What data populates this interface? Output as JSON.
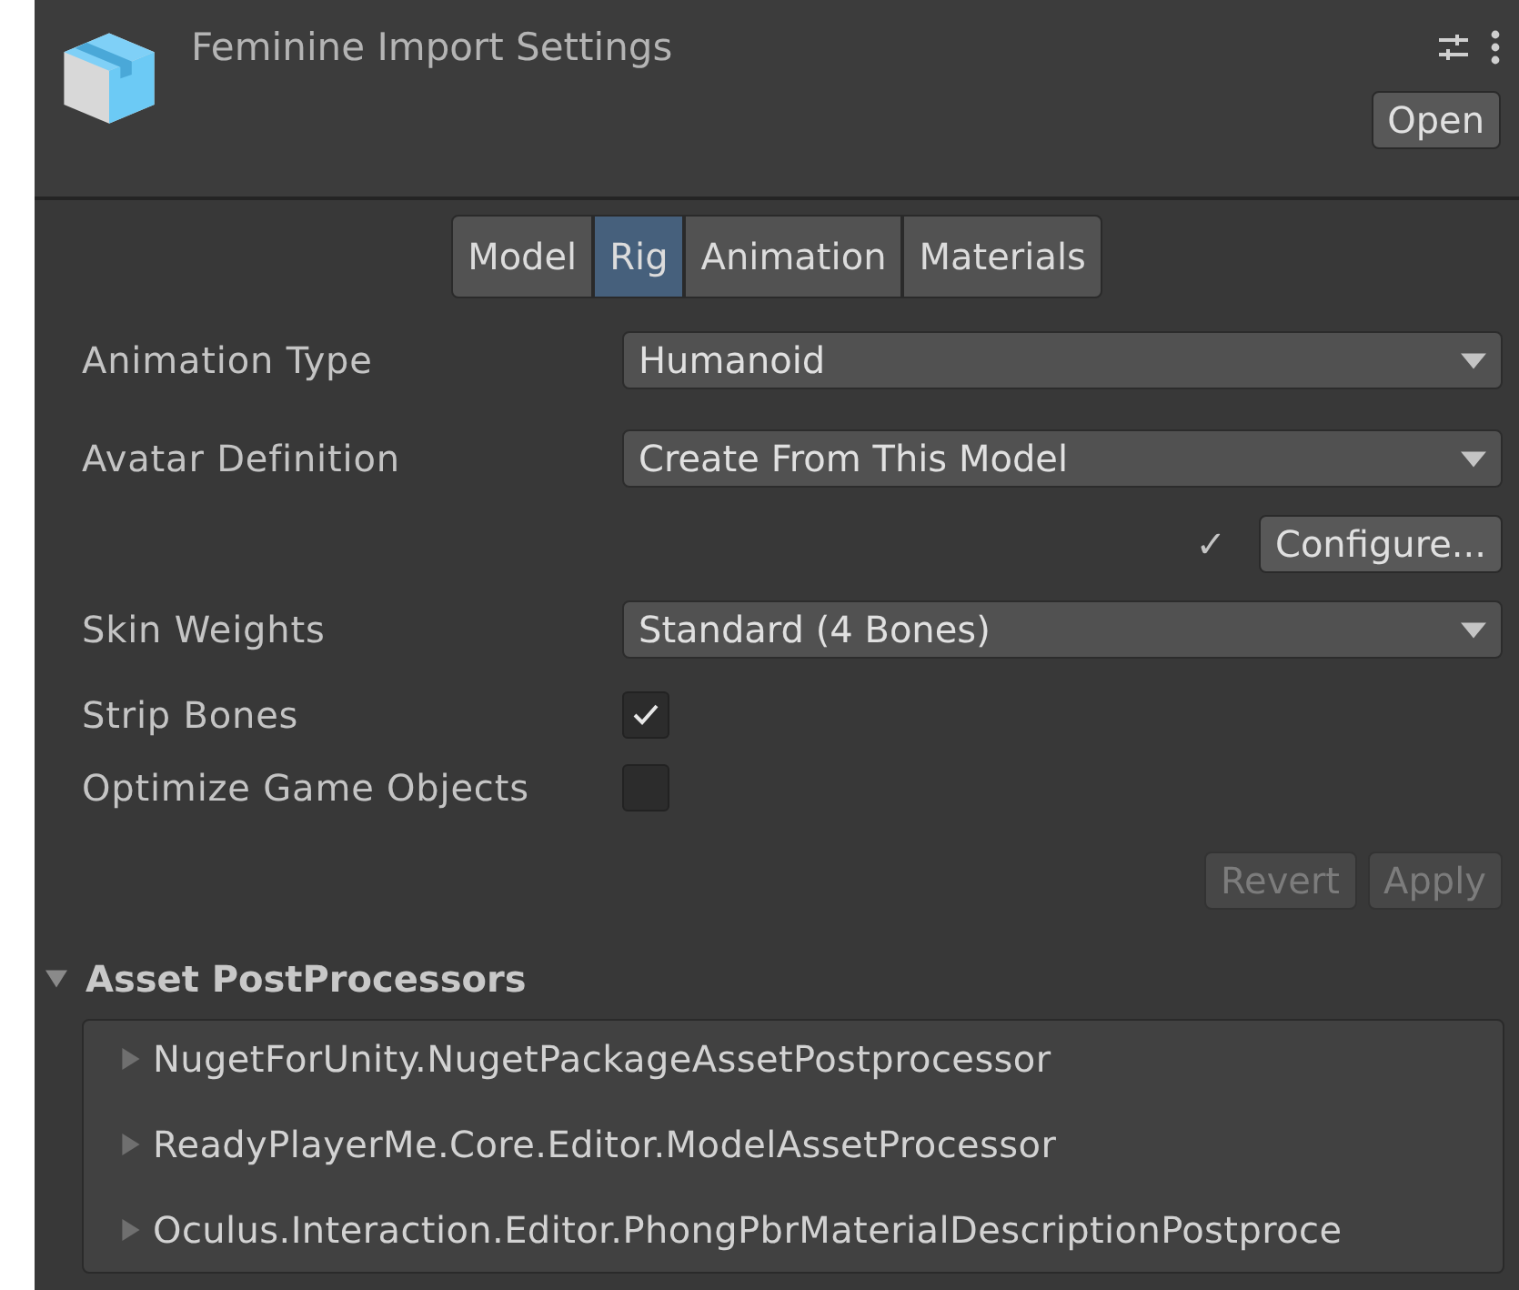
{
  "header": {
    "title": "Feminine Import Settings",
    "open_button": "Open"
  },
  "tabs": [
    {
      "label": "Model",
      "selected": false
    },
    {
      "label": "Rig",
      "selected": true
    },
    {
      "label": "Animation",
      "selected": false
    },
    {
      "label": "Materials",
      "selected": false
    }
  ],
  "fields": [
    {
      "kind": "dropdown",
      "label": "Animation Type",
      "value": "Humanoid"
    },
    {
      "kind": "dropdown",
      "label": "Avatar Definition",
      "value": "Create From This Model"
    },
    {
      "kind": "configure",
      "check": "✓",
      "button": "Configure..."
    },
    {
      "kind": "dropdown",
      "label": "Skin Weights",
      "value": "Standard (4 Bones)"
    },
    {
      "kind": "checkbox",
      "label": "Strip Bones",
      "checked": true
    },
    {
      "kind": "checkbox",
      "label": "Optimize Game Objects",
      "checked": false
    }
  ],
  "actions": [
    {
      "label": "Revert",
      "disabled": true
    },
    {
      "label": "Apply",
      "disabled": true
    }
  ],
  "postprocessors": {
    "title": "Asset PostProcessors",
    "expanded": true,
    "items": [
      {
        "label": "NugetForUnity.NugetPackageAssetPostprocessor",
        "expanded": false
      },
      {
        "label": "ReadyPlayerMe.Core.Editor.ModelAssetProcessor",
        "expanded": false
      },
      {
        "label": "Oculus.Interaction.Editor.PhongPbrMaterialDescriptionPostproce",
        "expanded": false
      }
    ]
  }
}
